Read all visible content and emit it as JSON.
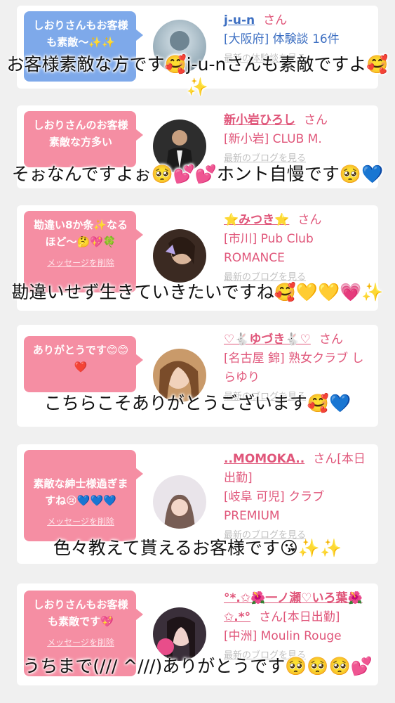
{
  "entries": [
    {
      "bubble": "しおりさんもお客様も素敵〜✨✨",
      "bubble_color": "#7ea9ea",
      "delete_label": "",
      "name": "j-u-n",
      "honorific": "さん",
      "shop": "[大阪府] 体験談 16件",
      "link": "最新の体験談を見る",
      "caption": "お客様素敵な方です🥰j-u-nさんも素敵ですよ🥰✨"
    },
    {
      "bubble": "しおりさんのお客様素敵な方多い",
      "bubble_color": "#f58ea3",
      "delete_label": "",
      "name": "新小岩ひろし",
      "honorific": "さん",
      "shop": "[新小岩] CLUB M.",
      "link": "最新のブログを見る",
      "caption": "そぉなんですよぉ🥺💕💕ホント自慢です🥺💙"
    },
    {
      "bubble": "勘違い8か条✨なるほど〜🤔💖🍀",
      "bubble_color": "#f58ea3",
      "delete_label": "メッセージを削除",
      "name": "⭐みつき⭐",
      "honorific": "さん",
      "shop": "[市川] Pub Club ROMANCE",
      "link": "最新のブログを見る",
      "caption": "勘違いせず生きていきたいですね🥰💛💛💗✨"
    },
    {
      "bubble": "ありがとうです😊😊❤️",
      "bubble_color": "#f58ea3",
      "delete_label": "",
      "name": "♡🐇ゆづき🐇♡",
      "honorific": "さん",
      "shop": "[名古屋 錦] 熟女クラブ しらゆり",
      "link": "最新のブログを見る",
      "caption": "こちらこそありがとうございます🥰💙"
    },
    {
      "bubble": "素敵な紳士様過ぎますね😢💙💙💙",
      "bubble_color": "#f58ea3",
      "delete_label": "メッセージを削除",
      "name": "..MOMOKA..",
      "honorific": "さん[本日出勤]",
      "shop": "[岐阜 可児] クラブ PREMIUM",
      "link": "最新のブログを見る",
      "caption": "色々教えて貰えるお客様です😘✨✨"
    },
    {
      "bubble": "しおりさんもお客様も素敵です💖",
      "bubble_color": "#f58ea3",
      "delete_label": "メッセージを削除",
      "name": "°*.✩🌺一ノ瀬♡いろ葉🌺✩.*°",
      "honorific": "さん[本日出勤]",
      "shop": "[中洲] Moulin Rouge",
      "link": "最新のブログを見る",
      "caption": "うちまで(/// ^///)ありがとうです🥺🥺🥺💕"
    }
  ]
}
